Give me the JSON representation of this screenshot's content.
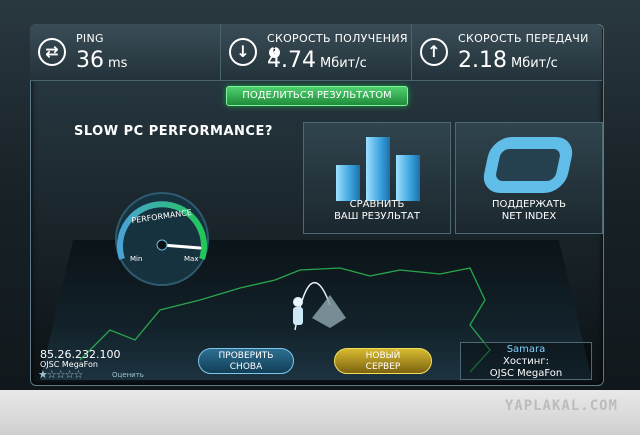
{
  "stats": {
    "ping": {
      "label": "PING",
      "value": "36",
      "unit": "ms",
      "icon": "ping-arrows-icon"
    },
    "download": {
      "label": "СКОРОСТЬ ПОЛУЧЕНИЯ",
      "value": "4.74",
      "unit": "Мбит/с",
      "icon": "download-arrow-icon"
    },
    "upload": {
      "label": "СКОРОСТЬ ПЕРЕДАЧИ",
      "value": "2.18",
      "unit": "Мбит/с",
      "icon": "upload-arrow-icon"
    }
  },
  "share_button": "ПОДЕЛИТЬСЯ РЕЗУЛЬТАТОМ",
  "promo_left": {
    "headline": "SLOW PC PERFORMANCE?"
  },
  "compare": {
    "line1": "СРАВНИТЬ",
    "line2": "ВАШ РЕЗУЛЬТАТ"
  },
  "netindex": {
    "line1": "ПОДДЕРЖАТЬ",
    "line2": "NET INDEX"
  },
  "gauge": {
    "label": "PERFORMANCE",
    "min": "Min",
    "max": "Max",
    "level": 0.85,
    "accent": "#22c65a"
  },
  "client": {
    "ip": "85.26.232.100",
    "isp": "OJSC MegaFon",
    "rating_label": "Оценить",
    "stars_filled": 1,
    "stars_total": 5
  },
  "buttons": {
    "retry_line1": "ПРОВЕРИТЬ",
    "retry_line2": "СНОВА",
    "server_line1": "НОВЫЙ",
    "server_line2": "СЕРВЕР"
  },
  "host": {
    "city": "Samara",
    "label": "Хостинг:",
    "name": "OJSC MegaFon"
  },
  "watermark": "YAPLAKAL.COM",
  "colors": {
    "green": "#2bbd52",
    "blue": "#5fbde8",
    "gold": "#d7b930",
    "city": "#7fd2ff"
  }
}
